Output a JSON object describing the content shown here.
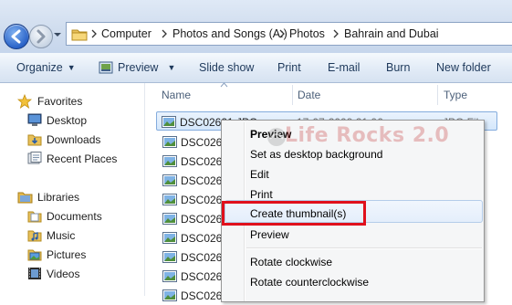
{
  "address_bar": {
    "crumbs": [
      "Computer",
      "Photos and Songs (A:)",
      "Photos",
      "Bahrain and Dubai"
    ]
  },
  "toolbar": {
    "organize": "Organize",
    "preview": "Preview",
    "slideshow": "Slide show",
    "print": "Print",
    "email": "E-mail",
    "burn": "Burn",
    "new_folder": "New folder"
  },
  "nav": {
    "favorites_header": "Favorites",
    "favorites": [
      "Desktop",
      "Downloads",
      "Recent Places"
    ],
    "libraries_header": "Libraries",
    "libraries": [
      "Documents",
      "Music",
      "Pictures",
      "Videos"
    ]
  },
  "columns": {
    "name": "Name",
    "date": "Date",
    "type": "Type"
  },
  "files": [
    {
      "name": "DSC02621.JPG",
      "date": "17-07-2009 21:06",
      "type": "JPG File"
    },
    {
      "name": "DSC026"
    },
    {
      "name": "DSC026"
    },
    {
      "name": "DSC026"
    },
    {
      "name": "DSC026"
    },
    {
      "name": "DSC026"
    },
    {
      "name": "DSC026"
    },
    {
      "name": "DSC026"
    },
    {
      "name": "DSC026"
    },
    {
      "name": "DSC026"
    }
  ],
  "context_menu": {
    "preview_bold": "Preview",
    "set_desktop": "Set as desktop background",
    "edit": "Edit",
    "print": "Print",
    "create_thumbnails": "Create thumbnail(s)",
    "preview": "Preview",
    "rotate_cw": "Rotate clockwise",
    "rotate_ccw": "Rotate counterclockwise"
  },
  "watermark": "Life Rocks 2.0",
  "colors": {
    "highlight_box": "#e0101c",
    "accent": "#1e395b"
  }
}
